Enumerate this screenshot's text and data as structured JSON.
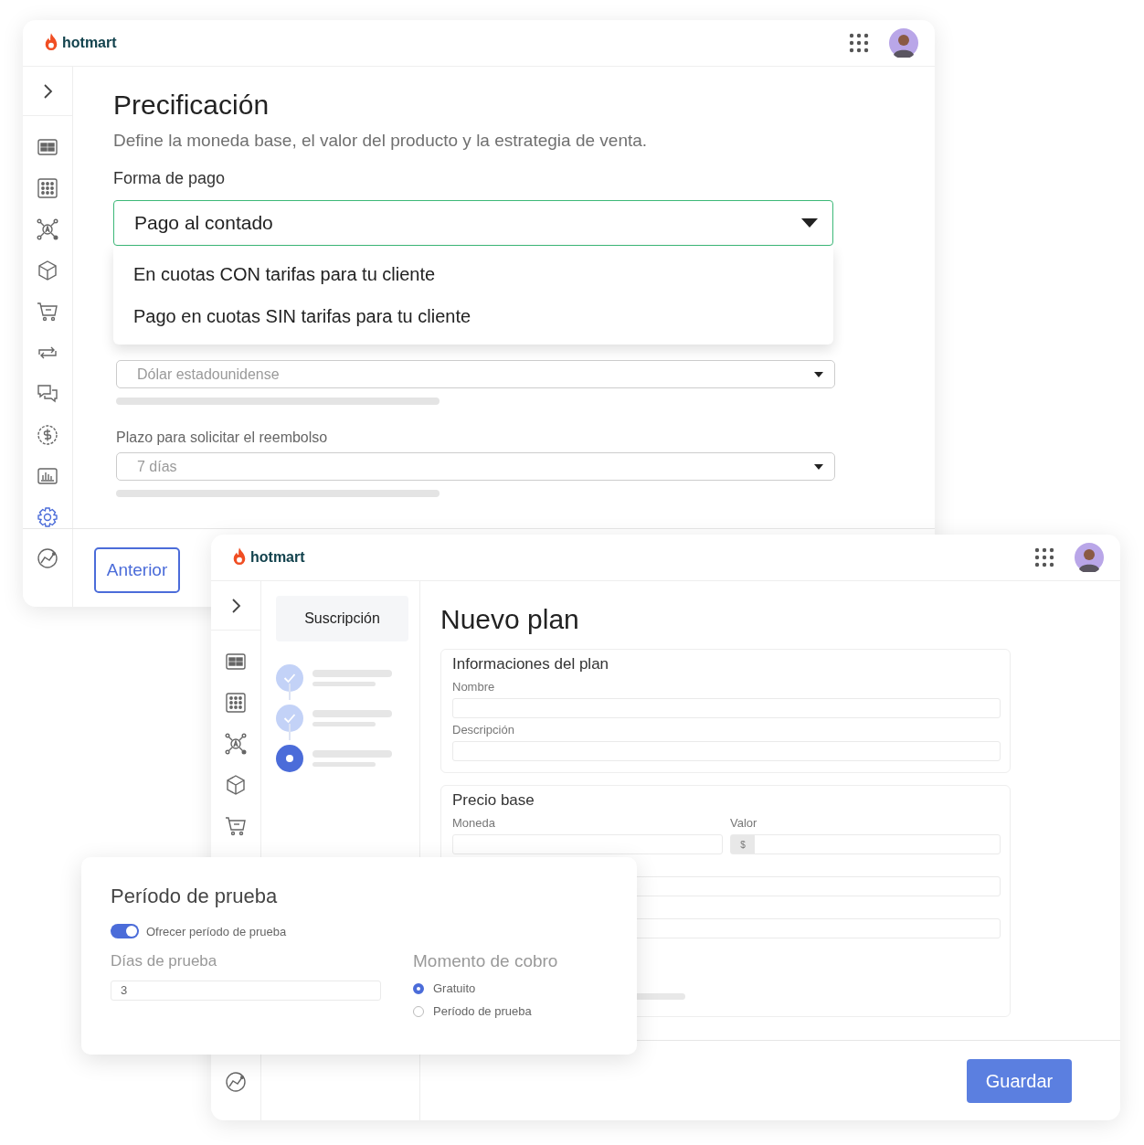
{
  "pricing_window": {
    "logo": "hotmart",
    "sidebar": {
      "items": [
        {
          "selected": false
        },
        {
          "selected": false
        },
        {
          "selected": false
        },
        {
          "selected": false
        },
        {
          "selected": false
        },
        {
          "selected": false
        },
        {
          "selected": false
        },
        {
          "selected": false
        },
        {
          "selected": false
        },
        {
          "selected": true
        },
        {
          "selected": false
        }
      ]
    },
    "title": "Precificación",
    "subtitle": "Define la moneda base, el valor del producto y la estrategia de venta.",
    "payment": {
      "label": "Forma de pago",
      "value": "Pago al contado",
      "expanded": true,
      "options": [
        {
          "label": "En cuotas CON tarifas para tu cliente",
          "selected": false
        },
        {
          "label": "Pago en cuotas SIN tarifas para tu cliente",
          "selected": false
        }
      ]
    },
    "currency": {
      "placeholder": "Dólar estadounidense"
    },
    "refund": {
      "label": "Plazo para solicitar el reembolso",
      "placeholder": "7 días"
    },
    "back_button": "Anterior"
  },
  "plan_window": {
    "logo": "hotmart",
    "sidebar": {
      "items": [
        {
          "selected": false
        },
        {
          "selected": false
        },
        {
          "selected": false
        },
        {
          "selected": false
        },
        {
          "selected": false
        },
        {
          "selected": false
        }
      ]
    },
    "tab": "Suscripción",
    "steps": [
      {
        "completed": true
      },
      {
        "completed": true
      },
      {
        "completed": false
      }
    ],
    "title": "Nuevo plan",
    "info_card": {
      "title": "Informaciones del plan",
      "fields": [
        {
          "label": "Nombre"
        },
        {
          "label": "Descripción"
        }
      ]
    },
    "price_card": {
      "title": "Precio base",
      "currency_label": "Moneda",
      "value_label": "Valor",
      "value_prefix": "$"
    },
    "save_button": "Guardar"
  },
  "trial_card": {
    "title": "Período de prueba",
    "toggle": {
      "label": "Ofrecer período de prueba",
      "on": true
    },
    "days": {
      "label": "Días de prueba",
      "value": "3"
    },
    "charge": {
      "label": "Momento de cobro",
      "options": [
        {
          "label": "Gratuito",
          "selected": true
        },
        {
          "label": "Período de prueba",
          "selected": false
        }
      ]
    }
  }
}
